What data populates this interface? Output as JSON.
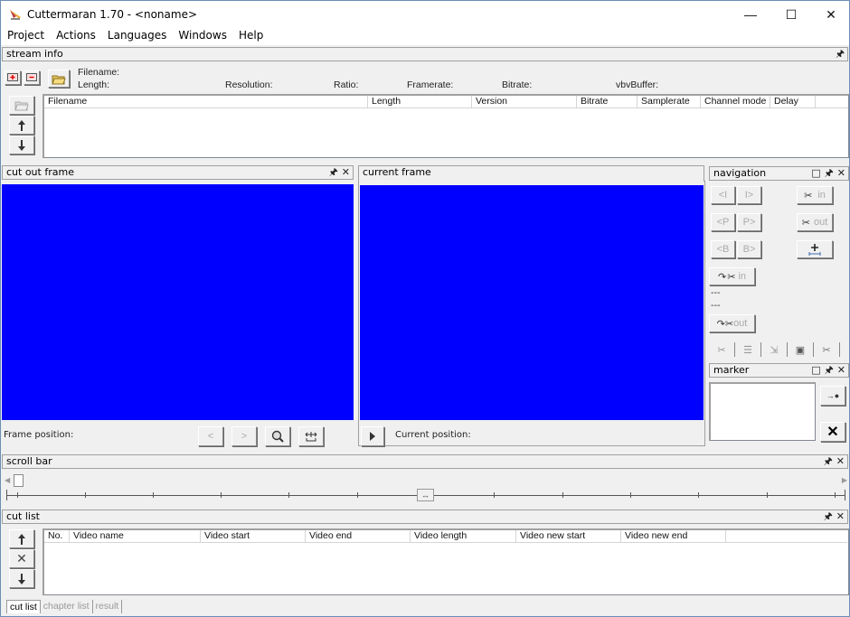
{
  "window": {
    "title": "Cuttermaran 1.70 - <noname>",
    "controls": {
      "minimize": "—",
      "maximize": "☐",
      "close": "✕"
    }
  },
  "menubar": [
    "Project",
    "Actions",
    "Languages",
    "Windows",
    "Help"
  ],
  "stream_info": {
    "title": "stream info",
    "pin": "⫟",
    "fields": {
      "filename": "Filename:",
      "length": "Length:",
      "resolution": "Resolution:",
      "ratio": "Ratio:",
      "framerate": "Framerate:",
      "bitrate": "Bitrate:",
      "vbvbuffer": "vbvBuffer:"
    },
    "audio_columns": [
      "Filename",
      "Length",
      "Version",
      "Bitrate",
      "Samplerate",
      "Channel mode",
      "Delay",
      ""
    ],
    "audio_rows": []
  },
  "cut_out_frame": {
    "title": "cut out frame",
    "frame_position_label": "Frame position:",
    "buttons": {
      "prev": "<",
      "next": ">"
    }
  },
  "current_frame": {
    "title": "current frame",
    "current_position_label": "Current position:"
  },
  "navigation": {
    "title": "navigation",
    "buttons": {
      "prev_i": "<I",
      "next_i": "I>",
      "prev_p": "<P",
      "next_p": "P>",
      "prev_b": "<B",
      "next_b": "B>",
      "cut_in": "in",
      "cut_out": "out",
      "goto_in": "in",
      "goto_out": "out"
    },
    "in_value": "---",
    "out_value": "---"
  },
  "marker": {
    "title": "marker",
    "items": []
  },
  "scroll_bar": {
    "title": "scroll bar",
    "position_percent": 0
  },
  "cut_list": {
    "title": "cut list",
    "columns": [
      "No.",
      "Video name",
      "Video start",
      "Video end",
      "Video length",
      "Video new start",
      "Video new end",
      ""
    ],
    "rows": [],
    "tabs": [
      "cut list",
      "chapter list",
      "result"
    ],
    "active_tab": "cut list"
  },
  "colors": {
    "video_background": "#0000ff",
    "window_border": "#6b8fb4"
  }
}
